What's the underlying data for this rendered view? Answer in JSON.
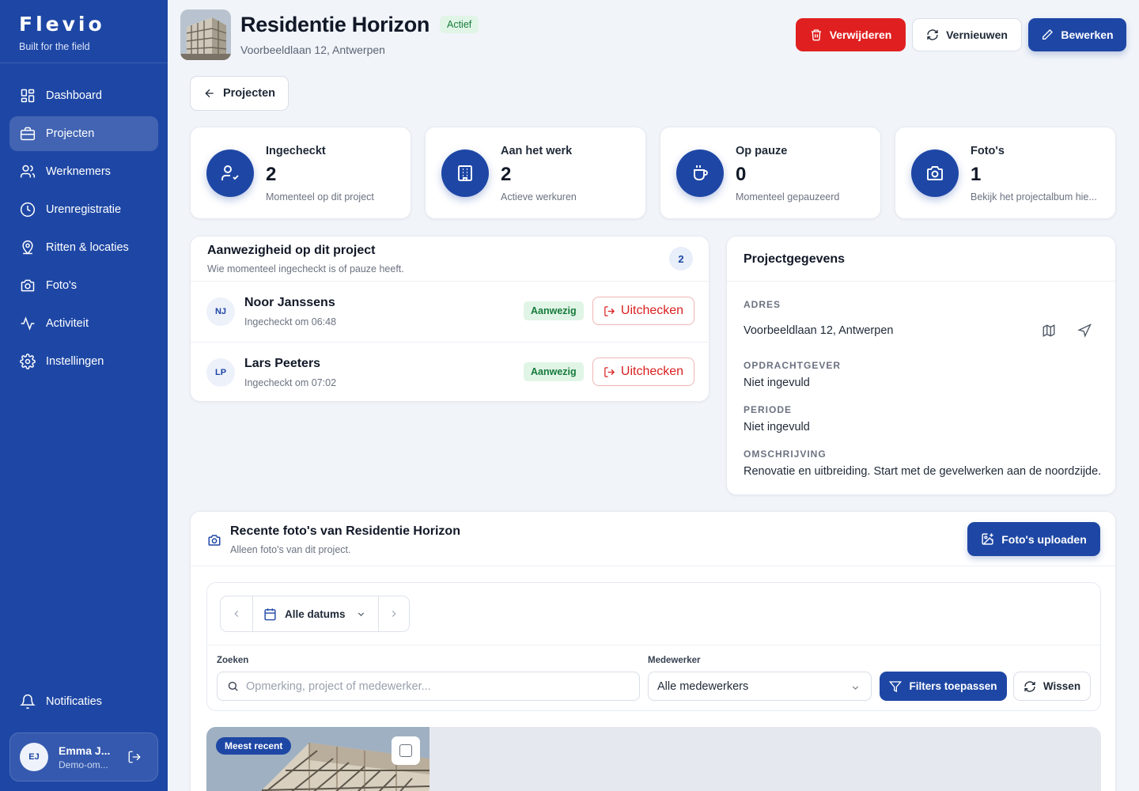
{
  "sidebar": {
    "brand": "Flevio",
    "tagline": "Built for the field",
    "nav": [
      {
        "label": "Dashboard",
        "icon": "grid-icon"
      },
      {
        "label": "Projecten",
        "icon": "briefcase-icon",
        "active": true
      },
      {
        "label": "Werknemers",
        "icon": "users-icon"
      },
      {
        "label": "Urenregistratie",
        "icon": "clock-icon"
      },
      {
        "label": "Ritten & locaties",
        "icon": "map-pin-user-icon"
      },
      {
        "label": "Foto's",
        "icon": "camera-icon"
      },
      {
        "label": "Activiteit",
        "icon": "activity-icon"
      },
      {
        "label": "Instellingen",
        "icon": "gear-icon"
      }
    ],
    "notifications_label": "Notificaties",
    "user": {
      "initials": "EJ",
      "name": "Emma J...",
      "role": "Demo-om..."
    }
  },
  "header": {
    "title": "Residentie Horizon",
    "status": "Actief",
    "address": "Voorbeeldlaan 12, Antwerpen",
    "delete_label": "Verwijderen",
    "refresh_label": "Vernieuwen",
    "edit_label": "Bewerken",
    "back_label": "Projecten"
  },
  "stats": [
    {
      "label": "Ingecheckt",
      "value": "2",
      "sub": "Momenteel op dit project",
      "icon": "user-check-icon"
    },
    {
      "label": "Aan het werk",
      "value": "2",
      "sub": "Actieve werkuren",
      "icon": "building-icon"
    },
    {
      "label": "Op pauze",
      "value": "0",
      "sub": "Momenteel gepauzeerd",
      "icon": "coffee-icon"
    },
    {
      "label": "Foto's",
      "value": "1",
      "sub": "Bekijk het projectalbum hie...",
      "icon": "camera-icon"
    }
  ],
  "attendance": {
    "title": "Aanwezigheid op dit project",
    "subtitle": "Wie momenteel ingecheckt is of pauze heeft.",
    "count": "2",
    "rows": [
      {
        "initials": "NJ",
        "name": "Noor Janssens",
        "time": "Ingecheckt om 06:48",
        "status": "Aanwezig",
        "action": "Uitchecken"
      },
      {
        "initials": "LP",
        "name": "Lars Peeters",
        "time": "Ingecheckt om 07:02",
        "status": "Aanwezig",
        "action": "Uitchecken"
      }
    ]
  },
  "details": {
    "title": "Projectgegevens",
    "address_label": "ADRES",
    "address_value": "Voorbeeldlaan 12, Antwerpen",
    "client_label": "OPDRACHTGEVER",
    "client_value": "Niet ingevuld",
    "period_label": "PERIODE",
    "period_value": "Niet ingevuld",
    "description_label": "OMSCHRIJVING",
    "description_value": "Renovatie en uitbreiding. Start met de gevelwerken aan de noordzijde."
  },
  "photos": {
    "title": "Recente foto's van Residentie Horizon",
    "subtitle": "Alleen foto's van dit project.",
    "upload_label": "Foto's uploaden",
    "date_filter": "Alle datums",
    "search_label": "Zoeken",
    "search_placeholder": "Opmerking, project of medewerker...",
    "employee_label": "Medewerker",
    "employee_value": "Alle medewerkers",
    "apply_label": "Filters toepassen",
    "clear_label": "Wissen",
    "recent_badge": "Meest recent"
  },
  "colors": {
    "primary": "#1e47a5",
    "danger": "#e02020",
    "success_bg": "#e1f5e7",
    "success_text": "#167b3b",
    "background": "#f1f4f9"
  }
}
